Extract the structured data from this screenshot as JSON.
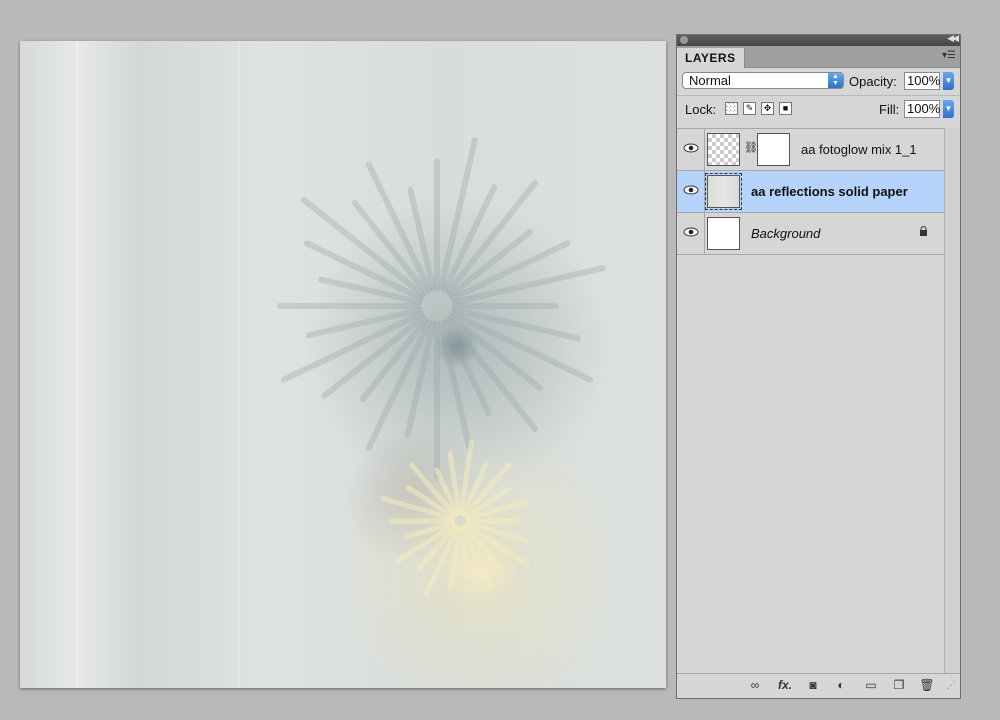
{
  "panel": {
    "tab_label": "LAYERS",
    "blend_mode": "Normal",
    "opacity_label": "Opacity:",
    "opacity_value": "100%",
    "lock_label": "Lock:",
    "fill_label": "Fill:",
    "fill_value": "100%"
  },
  "layers": [
    {
      "name": "aa fotoglow mix 1_1",
      "visible": true,
      "selected": false,
      "has_mask": true
    },
    {
      "name": "aa reflections solid paper",
      "visible": true,
      "selected": true,
      "has_mask": false
    },
    {
      "name": "Background",
      "visible": true,
      "selected": false,
      "locked": true,
      "italic": true
    }
  ],
  "footer_icons": [
    "link-icon",
    "fx-icon",
    "mask-icon",
    "adjustment-icon",
    "group-icon",
    "new-layer-icon",
    "trash-icon"
  ],
  "colors": {
    "selection": "#b6d3fb",
    "accent": "#2c6fcf",
    "panel_bg": "#d6d6d6"
  }
}
